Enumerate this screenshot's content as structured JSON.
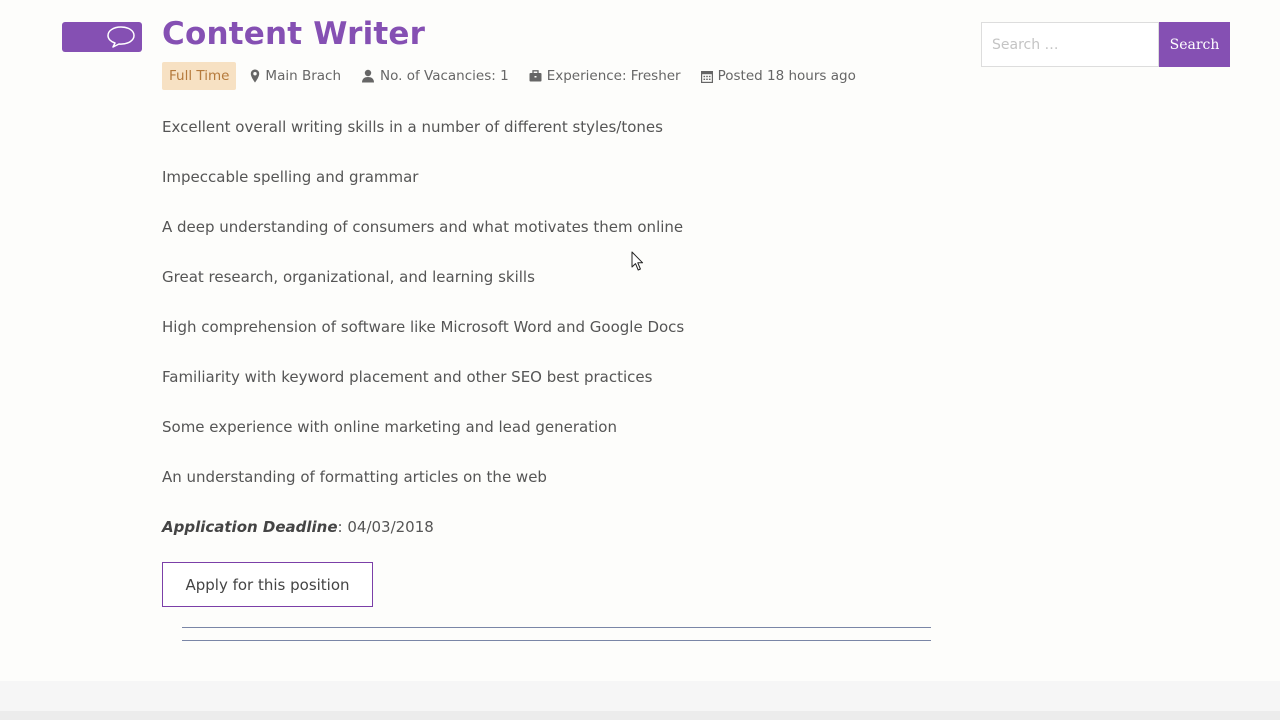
{
  "job": {
    "title": "Content Writer",
    "type": "Full Time",
    "location": "Main Brach",
    "vacancies": "No. of Vacancies: 1",
    "experience": "Experience: Fresher",
    "posted": "Posted 18 hours ago"
  },
  "search": {
    "placeholder": "Search …",
    "button_label": "Search"
  },
  "requirements": [
    "Excellent overall writing skills in a number of different styles/tones",
    "Impeccable spelling and grammar",
    "A deep understanding of consumers and what motivates them online",
    "Great research, organizational, and learning skills",
    "High comprehension of software like Microsoft Word and Google Docs",
    "Familiarity with keyword placement and other SEO best practices",
    "Some experience with online marketing and lead generation",
    "An understanding of formatting articles on the web"
  ],
  "deadline": {
    "label": "Application Deadline",
    "value": ": 04/03/2018"
  },
  "apply": {
    "label": "Apply for this position"
  },
  "colors": {
    "accent": "#8550b3",
    "badge_bg": "#f7e1c3",
    "badge_text": "#b57a3c",
    "rule": "#7a86a6"
  },
  "icons": [
    "speech-bubble-icon",
    "map-pin-icon",
    "user-icon",
    "briefcase-icon",
    "calendar-icon",
    "mouse-cursor-icon"
  ]
}
